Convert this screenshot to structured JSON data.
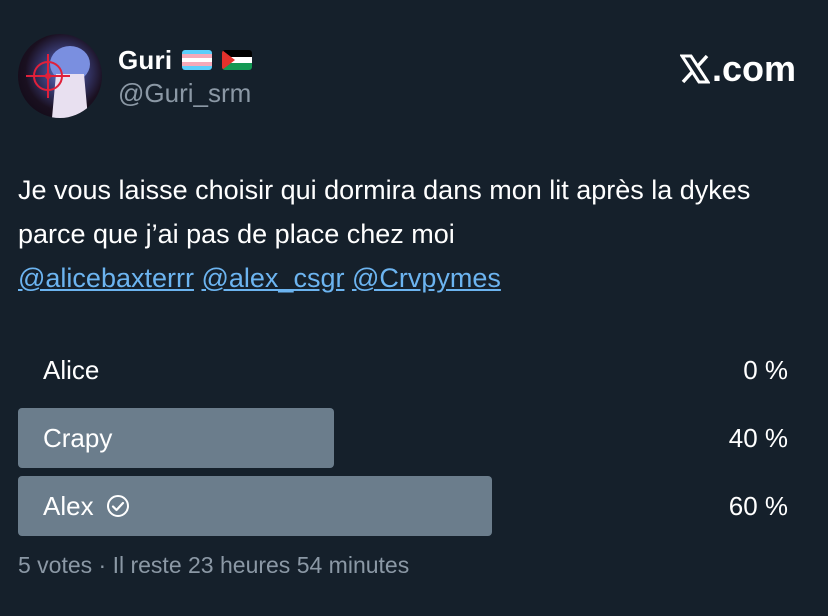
{
  "author": {
    "display_name": "Guri",
    "handle": "@Guri_srm",
    "flags": [
      "trans-flag-icon",
      "palestine-flag-icon"
    ]
  },
  "brand": {
    "label": ".com",
    "logo_icon": "x-logo-icon"
  },
  "tweet": {
    "text": "Je vous laisse choisir qui dormira dans mon lit après la dykes parce que j’ai pas de place chez moi",
    "mentions": [
      "@alicebaxterrr",
      "@alex_csgr",
      "@Crvpymes"
    ]
  },
  "poll": {
    "options": [
      {
        "label": "Alice",
        "percent_text": "0 %",
        "percent": 0,
        "winner": false
      },
      {
        "label": "Crapy",
        "percent_text": "40 %",
        "percent": 40,
        "winner": false
      },
      {
        "label": "Alex",
        "percent_text": "60 %",
        "percent": 60,
        "winner": true
      }
    ],
    "meta": "5 votes · Il reste 23 heures 54 minutes"
  },
  "colors": {
    "background": "#15202b",
    "bar": "#6b7d8c",
    "link": "#6cb4f0",
    "secondary_text": "#8b98a5"
  }
}
